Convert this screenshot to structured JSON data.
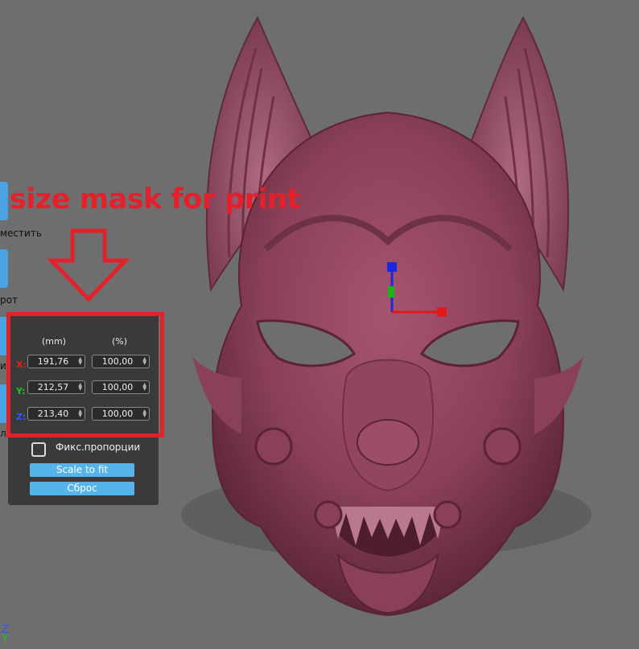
{
  "toolbar": {
    "items": [
      {
        "label": "местить"
      },
      {
        "label": "рот"
      },
      {
        "label": "ит"
      },
      {
        "label": "л"
      }
    ]
  },
  "annotation": {
    "text": "size mask for print",
    "color": "#e4212b"
  },
  "scale_panel": {
    "headers": {
      "mm": "(mm)",
      "percent": "(%)"
    },
    "axes": [
      {
        "label": "X:",
        "mm": "191,76",
        "percent": "100,00",
        "color": "#e02020"
      },
      {
        "label": "Y:",
        "mm": "212,57",
        "percent": "100,00",
        "color": "#22c222"
      },
      {
        "label": "Z:",
        "mm": "213,40",
        "percent": "100,00",
        "color": "#3355ff"
      }
    ],
    "lock_proportions_label": "Фикс.пропорции",
    "lock_proportions_checked": false,
    "scale_to_fit_label": "Scale to fit",
    "reset_label": "Сброс"
  },
  "viewport": {
    "model": "fox-mask",
    "model_color": "#8c4058",
    "background_color": "#6e6e6e"
  },
  "axis_indicator": {
    "z": "Z",
    "y": "Y"
  }
}
